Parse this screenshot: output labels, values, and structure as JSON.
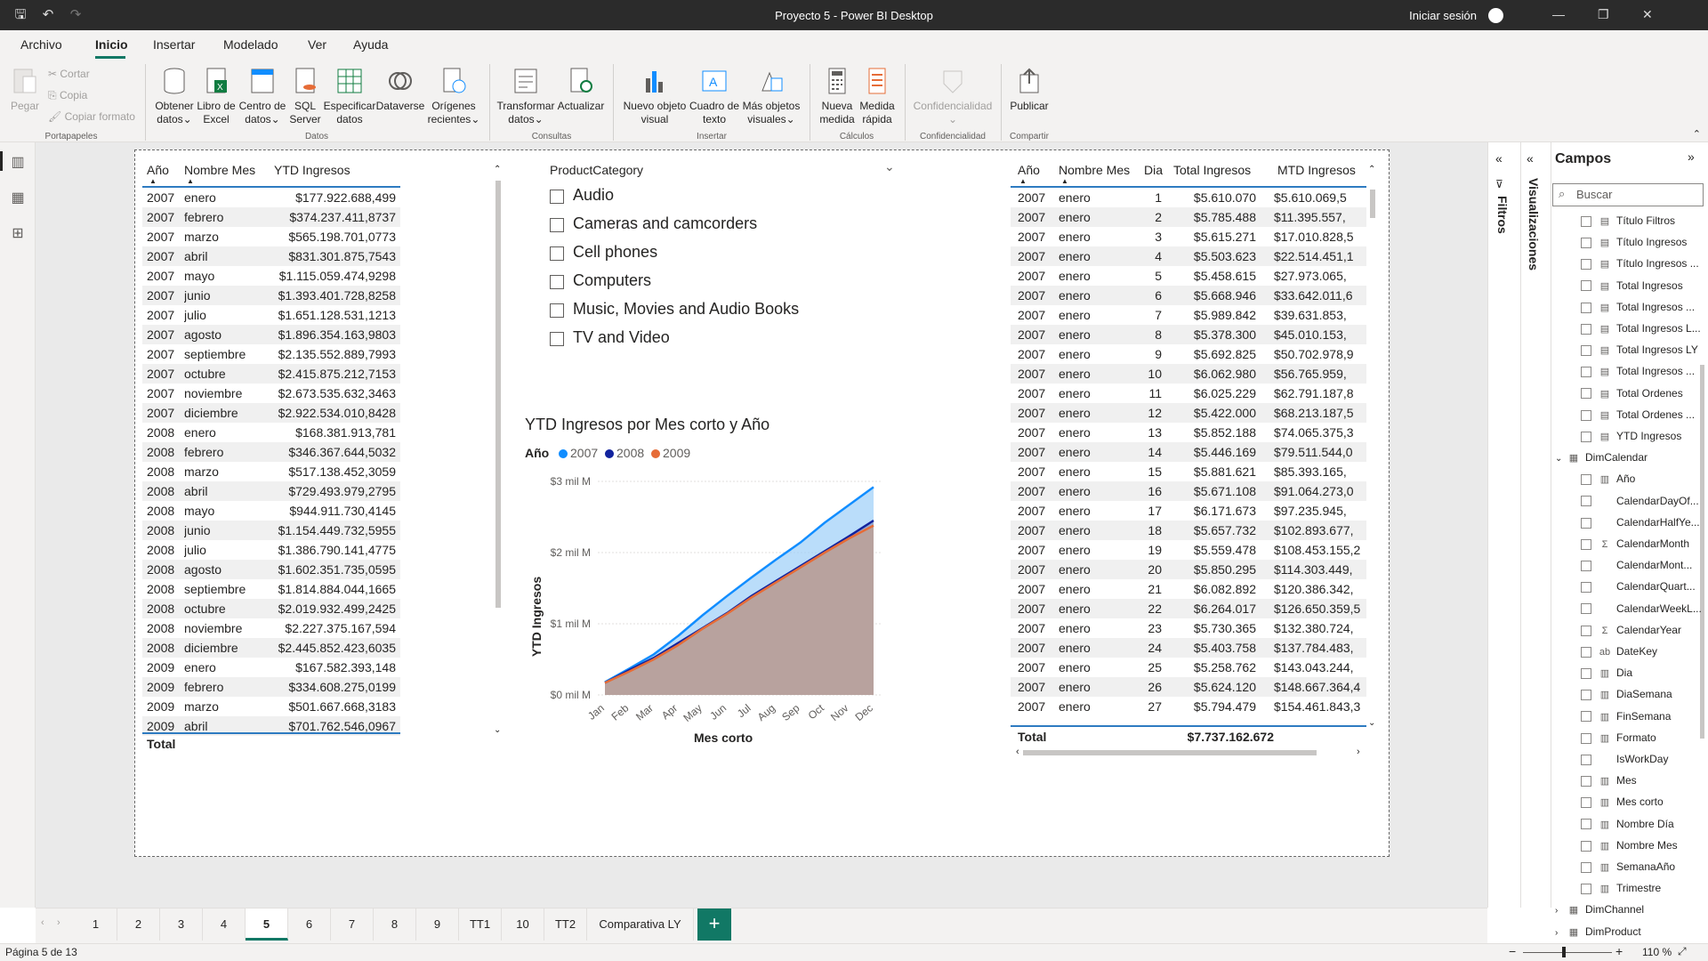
{
  "window": {
    "title": "Proyecto 5 - Power BI Desktop",
    "signin": "Iniciar sesión"
  },
  "menu": [
    "Archivo",
    "Inicio",
    "Insertar",
    "Modelado",
    "Ver",
    "Ayuda"
  ],
  "ribbon": {
    "clipboard": {
      "paste": "Pegar",
      "cut": "Cortar",
      "copy": "Copia",
      "format": "Copiar formato",
      "group": "Portapapeles"
    },
    "data": {
      "get": [
        "Obtener",
        "datos"
      ],
      "excel": [
        "Libro de",
        "Excel"
      ],
      "hub": [
        "Centro de",
        "datos"
      ],
      "sql": [
        "SQL",
        "Server"
      ],
      "enter": [
        "Especificar",
        "datos"
      ],
      "dataverse": "Dataverse",
      "recent": [
        "Orígenes",
        "recientes"
      ],
      "group": "Datos"
    },
    "queries": {
      "transform": [
        "Transformar",
        "datos"
      ],
      "refresh": "Actualizar",
      "group": "Consultas"
    },
    "insert": {
      "visual": [
        "Nuevo objeto",
        "visual"
      ],
      "textbox": [
        "Cuadro de",
        "texto"
      ],
      "more": [
        "Más objetos",
        "visuales"
      ],
      "group": "Insertar"
    },
    "calc": {
      "measure": [
        "Nueva",
        "medida"
      ],
      "quick": [
        "Medida",
        "rápida"
      ],
      "group": "Cálculos"
    },
    "sensitivity": {
      "label": "Confidencialidad",
      "group": "Confidencialidad"
    },
    "share": {
      "publish": "Publicar",
      "group": "Compartir"
    }
  },
  "left_table": {
    "headers": [
      "Año",
      "Nombre Mes",
      "YTD Ingresos"
    ],
    "rows": [
      [
        "2007",
        "enero",
        "$177.922.688,499"
      ],
      [
        "2007",
        "febrero",
        "$374.237.411,8737"
      ],
      [
        "2007",
        "marzo",
        "$565.198.701,0773"
      ],
      [
        "2007",
        "abril",
        "$831.301.875,7543"
      ],
      [
        "2007",
        "mayo",
        "$1.115.059.474,9298"
      ],
      [
        "2007",
        "junio",
        "$1.393.401.728,8258"
      ],
      [
        "2007",
        "julio",
        "$1.651.128.531,1213"
      ],
      [
        "2007",
        "agosto",
        "$1.896.354.163,9803"
      ],
      [
        "2007",
        "septiembre",
        "$2.135.552.889,7993"
      ],
      [
        "2007",
        "octubre",
        "$2.415.875.212,7153"
      ],
      [
        "2007",
        "noviembre",
        "$2.673.535.632,3463"
      ],
      [
        "2007",
        "diciembre",
        "$2.922.534.010,8428"
      ],
      [
        "2008",
        "enero",
        "$168.381.913,781"
      ],
      [
        "2008",
        "febrero",
        "$346.367.644,5032"
      ],
      [
        "2008",
        "marzo",
        "$517.138.452,3059"
      ],
      [
        "2008",
        "abril",
        "$729.493.979,2795"
      ],
      [
        "2008",
        "mayo",
        "$944.911.730,4145"
      ],
      [
        "2008",
        "junio",
        "$1.154.449.732,5955"
      ],
      [
        "2008",
        "julio",
        "$1.386.790.141,4775"
      ],
      [
        "2008",
        "agosto",
        "$1.602.351.735,0595"
      ],
      [
        "2008",
        "septiembre",
        "$1.814.884.044,1665"
      ],
      [
        "2008",
        "octubre",
        "$2.019.932.499,2425"
      ],
      [
        "2008",
        "noviembre",
        "$2.227.375.167,594"
      ],
      [
        "2008",
        "diciembre",
        "$2.445.852.423,6035"
      ],
      [
        "2009",
        "enero",
        "$167.582.393,148"
      ],
      [
        "2009",
        "febrero",
        "$334.608.275,0199"
      ],
      [
        "2009",
        "marzo",
        "$501.667.668,3183"
      ],
      [
        "2009",
        "abril",
        "$701.762.546,0967"
      ]
    ],
    "total_label": "Total"
  },
  "slicer": {
    "title": "ProductCategory",
    "items": [
      "Audio",
      "Cameras and camcorders",
      "Cell phones",
      "Computers",
      "Music, Movies and Audio Books",
      "TV and Video"
    ]
  },
  "chart_data": {
    "type": "area",
    "title": "YTD Ingresos por Mes corto y Año",
    "legend_title": "Año",
    "xlabel": "Mes corto",
    "ylabel": "YTD Ingresos",
    "categories": [
      "Jan",
      "Feb",
      "Mar",
      "Apr",
      "May",
      "Jun",
      "Jul",
      "Aug",
      "Sep",
      "Oct",
      "Nov",
      "Dec"
    ],
    "yticks": [
      "$0 mil M",
      "$1 mil M",
      "$2 mil M",
      "$3 mil M"
    ],
    "ylim": [
      0,
      3
    ],
    "y_unit": "mil M",
    "series": [
      {
        "name": "2007",
        "color": "#118DFF",
        "values": [
          0.18,
          0.37,
          0.57,
          0.83,
          1.12,
          1.39,
          1.65,
          1.9,
          2.14,
          2.42,
          2.67,
          2.92
        ]
      },
      {
        "name": "2008",
        "color": "#12239E",
        "values": [
          0.17,
          0.35,
          0.52,
          0.73,
          0.94,
          1.15,
          1.39,
          1.6,
          1.81,
          2.02,
          2.23,
          2.45
        ]
      },
      {
        "name": "2009",
        "color": "#E66C37",
        "values": [
          0.17,
          0.33,
          0.5,
          0.7,
          0.93,
          1.14,
          1.37,
          1.58,
          1.79,
          2.0,
          2.2,
          2.38
        ]
      }
    ]
  },
  "right_table": {
    "headers": [
      "Año",
      "Nombre Mes",
      "Dia",
      "Total Ingresos",
      "MTD Ingresos"
    ],
    "rows": [
      [
        "2007",
        "enero",
        "1",
        "$5.610.070",
        "$5.610.069,5"
      ],
      [
        "2007",
        "enero",
        "2",
        "$5.785.488",
        "$11.395.557,"
      ],
      [
        "2007",
        "enero",
        "3",
        "$5.615.271",
        "$17.010.828,5"
      ],
      [
        "2007",
        "enero",
        "4",
        "$5.503.623",
        "$22.514.451,1"
      ],
      [
        "2007",
        "enero",
        "5",
        "$5.458.615",
        "$27.973.065,"
      ],
      [
        "2007",
        "enero",
        "6",
        "$5.668.946",
        "$33.642.011,6"
      ],
      [
        "2007",
        "enero",
        "7",
        "$5.989.842",
        "$39.631.853,"
      ],
      [
        "2007",
        "enero",
        "8",
        "$5.378.300",
        "$45.010.153,"
      ],
      [
        "2007",
        "enero",
        "9",
        "$5.692.825",
        "$50.702.978,9"
      ],
      [
        "2007",
        "enero",
        "10",
        "$6.062.980",
        "$56.765.959,"
      ],
      [
        "2007",
        "enero",
        "11",
        "$6.025.229",
        "$62.791.187,8"
      ],
      [
        "2007",
        "enero",
        "12",
        "$5.422.000",
        "$68.213.187,5"
      ],
      [
        "2007",
        "enero",
        "13",
        "$5.852.188",
        "$74.065.375,3"
      ],
      [
        "2007",
        "enero",
        "14",
        "$5.446.169",
        "$79.511.544,0"
      ],
      [
        "2007",
        "enero",
        "15",
        "$5.881.621",
        "$85.393.165,"
      ],
      [
        "2007",
        "enero",
        "16",
        "$5.671.108",
        "$91.064.273,0"
      ],
      [
        "2007",
        "enero",
        "17",
        "$6.171.673",
        "$97.235.945,"
      ],
      [
        "2007",
        "enero",
        "18",
        "$5.657.732",
        "$102.893.677,"
      ],
      [
        "2007",
        "enero",
        "19",
        "$5.559.478",
        "$108.453.155,2"
      ],
      [
        "2007",
        "enero",
        "20",
        "$5.850.295",
        "$114.303.449,"
      ],
      [
        "2007",
        "enero",
        "21",
        "$6.082.892",
        "$120.386.342,"
      ],
      [
        "2007",
        "enero",
        "22",
        "$6.264.017",
        "$126.650.359,5"
      ],
      [
        "2007",
        "enero",
        "23",
        "$5.730.365",
        "$132.380.724,"
      ],
      [
        "2007",
        "enero",
        "24",
        "$5.403.758",
        "$137.784.483,"
      ],
      [
        "2007",
        "enero",
        "25",
        "$5.258.762",
        "$143.043.244,"
      ],
      [
        "2007",
        "enero",
        "26",
        "$5.624.120",
        "$148.667.364,4"
      ],
      [
        "2007",
        "enero",
        "27",
        "$5.794.479",
        "$154.461.843,3"
      ]
    ],
    "total_label": "Total",
    "total_value": "$7.737.162.672"
  },
  "right_pane": {
    "filters_label": "Filtros",
    "viz_label": "Visualizaciones",
    "fields_title": "Campos",
    "search_placeholder": "Buscar",
    "fields": [
      {
        "t": "Título Filtros",
        "i": "calc",
        "c": false,
        "l": 1
      },
      {
        "t": "Título Ingresos",
        "i": "calc",
        "c": false,
        "l": 1
      },
      {
        "t": "Título Ingresos ...",
        "i": "calc",
        "c": false,
        "l": 1
      },
      {
        "t": "Total Ingresos",
        "i": "calc",
        "c": false,
        "l": 1
      },
      {
        "t": "Total Ingresos ...",
        "i": "calc",
        "c": false,
        "l": 1
      },
      {
        "t": "Total Ingresos L...",
        "i": "calc",
        "c": false,
        "l": 1
      },
      {
        "t": "Total Ingresos LY",
        "i": "calc",
        "c": false,
        "l": 1
      },
      {
        "t": "Total Ingresos ...",
        "i": "calc",
        "c": false,
        "l": 1
      },
      {
        "t": "Total Ordenes",
        "i": "calc",
        "c": false,
        "l": 1
      },
      {
        "t": "Total Ordenes ...",
        "i": "calc",
        "c": false,
        "l": 1
      },
      {
        "t": "YTD Ingresos",
        "i": "calc",
        "c": false,
        "l": 1
      },
      {
        "t": "DimCalendar",
        "i": "table",
        "c": null,
        "l": 0
      },
      {
        "t": "Año",
        "i": "hier",
        "c": false,
        "l": 1
      },
      {
        "t": "CalendarDayOf...",
        "i": "",
        "c": false,
        "l": 1
      },
      {
        "t": "CalendarHalfYe...",
        "i": "",
        "c": false,
        "l": 1
      },
      {
        "t": "CalendarMonth",
        "i": "sum",
        "c": false,
        "l": 1
      },
      {
        "t": "CalendarMont...",
        "i": "",
        "c": false,
        "l": 1
      },
      {
        "t": "CalendarQuart...",
        "i": "",
        "c": false,
        "l": 1
      },
      {
        "t": "CalendarWeekL...",
        "i": "",
        "c": false,
        "l": 1
      },
      {
        "t": "CalendarYear",
        "i": "sum",
        "c": false,
        "l": 1
      },
      {
        "t": "DateKey",
        "i": "text",
        "c": false,
        "l": 1
      },
      {
        "t": "Dia",
        "i": "hier",
        "c": false,
        "l": 1
      },
      {
        "t": "DiaSemana",
        "i": "hier",
        "c": false,
        "l": 1
      },
      {
        "t": "FinSemana",
        "i": "hier",
        "c": false,
        "l": 1
      },
      {
        "t": "Formato",
        "i": "hier",
        "c": false,
        "l": 1
      },
      {
        "t": "IsWorkDay",
        "i": "",
        "c": false,
        "l": 1
      },
      {
        "t": "Mes",
        "i": "hier",
        "c": false,
        "l": 1
      },
      {
        "t": "Mes corto",
        "i": "hier",
        "c": false,
        "l": 1
      },
      {
        "t": "Nombre Día",
        "i": "hier",
        "c": false,
        "l": 1
      },
      {
        "t": "Nombre Mes",
        "i": "hier",
        "c": false,
        "l": 1
      },
      {
        "t": "SemanaAño",
        "i": "hier",
        "c": false,
        "l": 1
      },
      {
        "t": "Trimestre",
        "i": "hier",
        "c": false,
        "l": 1
      },
      {
        "t": "DimChannel",
        "i": "table",
        "c": null,
        "l": 0
      },
      {
        "t": "DimProduct",
        "i": "table",
        "c": null,
        "l": 0
      }
    ]
  },
  "pages": [
    "1",
    "2",
    "3",
    "4",
    "5",
    "6",
    "7",
    "8",
    "9",
    "TT1",
    "10",
    "TT2",
    "Comparativa LY"
  ],
  "active_page": "5",
  "status": {
    "page": "Página 5 de 13",
    "zoom": "110 %"
  }
}
